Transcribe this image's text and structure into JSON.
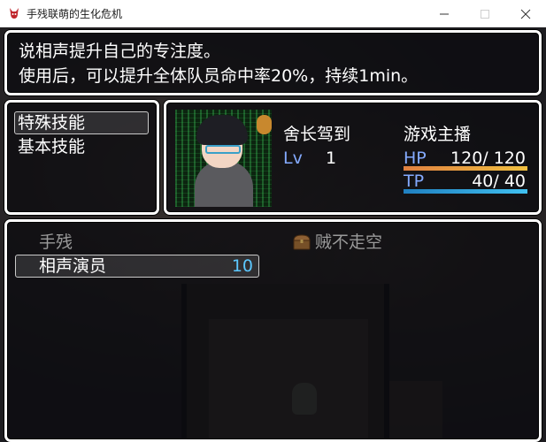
{
  "window": {
    "title": "手残联萌的生化危机",
    "icon": "demon-app-icon",
    "controls": {
      "minimize": "—",
      "maximize": "☐",
      "close": "✕"
    }
  },
  "help": {
    "line1": "说相声提升自己的专注度。",
    "line2": "使用后，可以提升全体队员命中率20%，持续1min。"
  },
  "skill_types": [
    {
      "label": "特殊技能",
      "selected": true
    },
    {
      "label": "基本技能",
      "selected": false
    }
  ],
  "actor": {
    "name": "舍长驾到",
    "class": "游戏主播",
    "lv_label": "Lv",
    "level": "1",
    "hp_label": "HP",
    "hp_text": "120/ 120",
    "hp_rate": 1.0,
    "tp_label": "TP",
    "tp_text": "40/  40",
    "tp_rate": 1.0,
    "colors": {
      "hp_gauge": "#e08040",
      "tp_gauge": "#2080c0",
      "system_label": "#84aaff"
    }
  },
  "skills": {
    "category": "手残",
    "items": [
      {
        "name": "相声演员",
        "cost": "10",
        "cost_color": "#5cc8ff",
        "selected": true,
        "enabled": true
      },
      {
        "name": "贼不走空",
        "cost": "",
        "icon": "treasure-chest-icon",
        "selected": false,
        "enabled": false
      }
    ]
  }
}
